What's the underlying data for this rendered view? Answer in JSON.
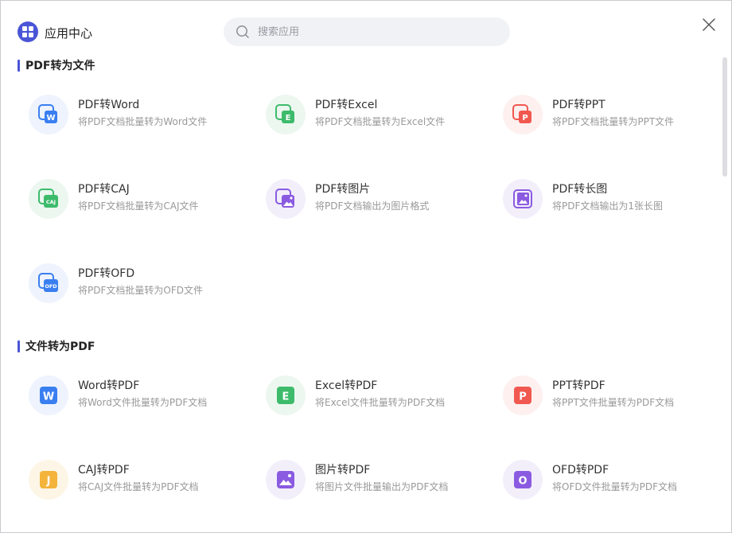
{
  "header": {
    "app_icon": "app-grid-icon",
    "title": "应用中心",
    "search_placeholder": "搜索应用",
    "search_icon": "search-icon",
    "close_icon": "close-icon"
  },
  "sections": [
    {
      "title": "PDF转为文件",
      "items": [
        {
          "name": "PDF转Word",
          "desc": "将PDF文档批量转为Word文件",
          "icon": "pdf-to-word-icon"
        },
        {
          "name": "PDF转Excel",
          "desc": "将PDF文档批量转为Excel文件",
          "icon": "pdf-to-excel-icon"
        },
        {
          "name": "PDF转PPT",
          "desc": "将PDF文档批量转为PPT文件",
          "icon": "pdf-to-ppt-icon"
        },
        {
          "name": "PDF转CAJ",
          "desc": "将PDF文档批量转为CAJ文件",
          "icon": "pdf-to-caj-icon"
        },
        {
          "name": "PDF转图片",
          "desc": "将PDF文档输出为图片格式",
          "icon": "pdf-to-image-icon"
        },
        {
          "name": "PDF转长图",
          "desc": "将PDF文档输出为1张长图",
          "icon": "pdf-to-long-image-icon"
        },
        {
          "name": "PDF转OFD",
          "desc": "将PDF文档批量转为OFD文件",
          "icon": "pdf-to-ofd-icon"
        }
      ]
    },
    {
      "title": "文件转为PDF",
      "items": [
        {
          "name": "Word转PDF",
          "desc": "将Word文件批量转为PDF文档",
          "icon": "word-to-pdf-icon"
        },
        {
          "name": "Excel转PDF",
          "desc": "将Excel文件批量转为PDF文档",
          "icon": "excel-to-pdf-icon"
        },
        {
          "name": "PPT转PDF",
          "desc": "将PPT文件批量转为PDF文档",
          "icon": "ppt-to-pdf-icon"
        },
        {
          "name": "CAJ转PDF",
          "desc": "将CAJ文件批量转为PDF文档",
          "icon": "caj-to-pdf-icon"
        },
        {
          "name": "图片转PDF",
          "desc": "将图片文件批量输出为PDF文档",
          "icon": "image-to-pdf-icon"
        },
        {
          "name": "OFD转PDF",
          "desc": "将OFD文件批量转为PDF文档",
          "icon": "ofd-to-pdf-icon"
        }
      ]
    }
  ],
  "colors": {
    "accent": "#4a55d6",
    "word": "#3a7ff0",
    "excel": "#3dbb6b",
    "ppt": "#f1584f",
    "image": "#8a5be0",
    "caj": "#f4b33a"
  }
}
